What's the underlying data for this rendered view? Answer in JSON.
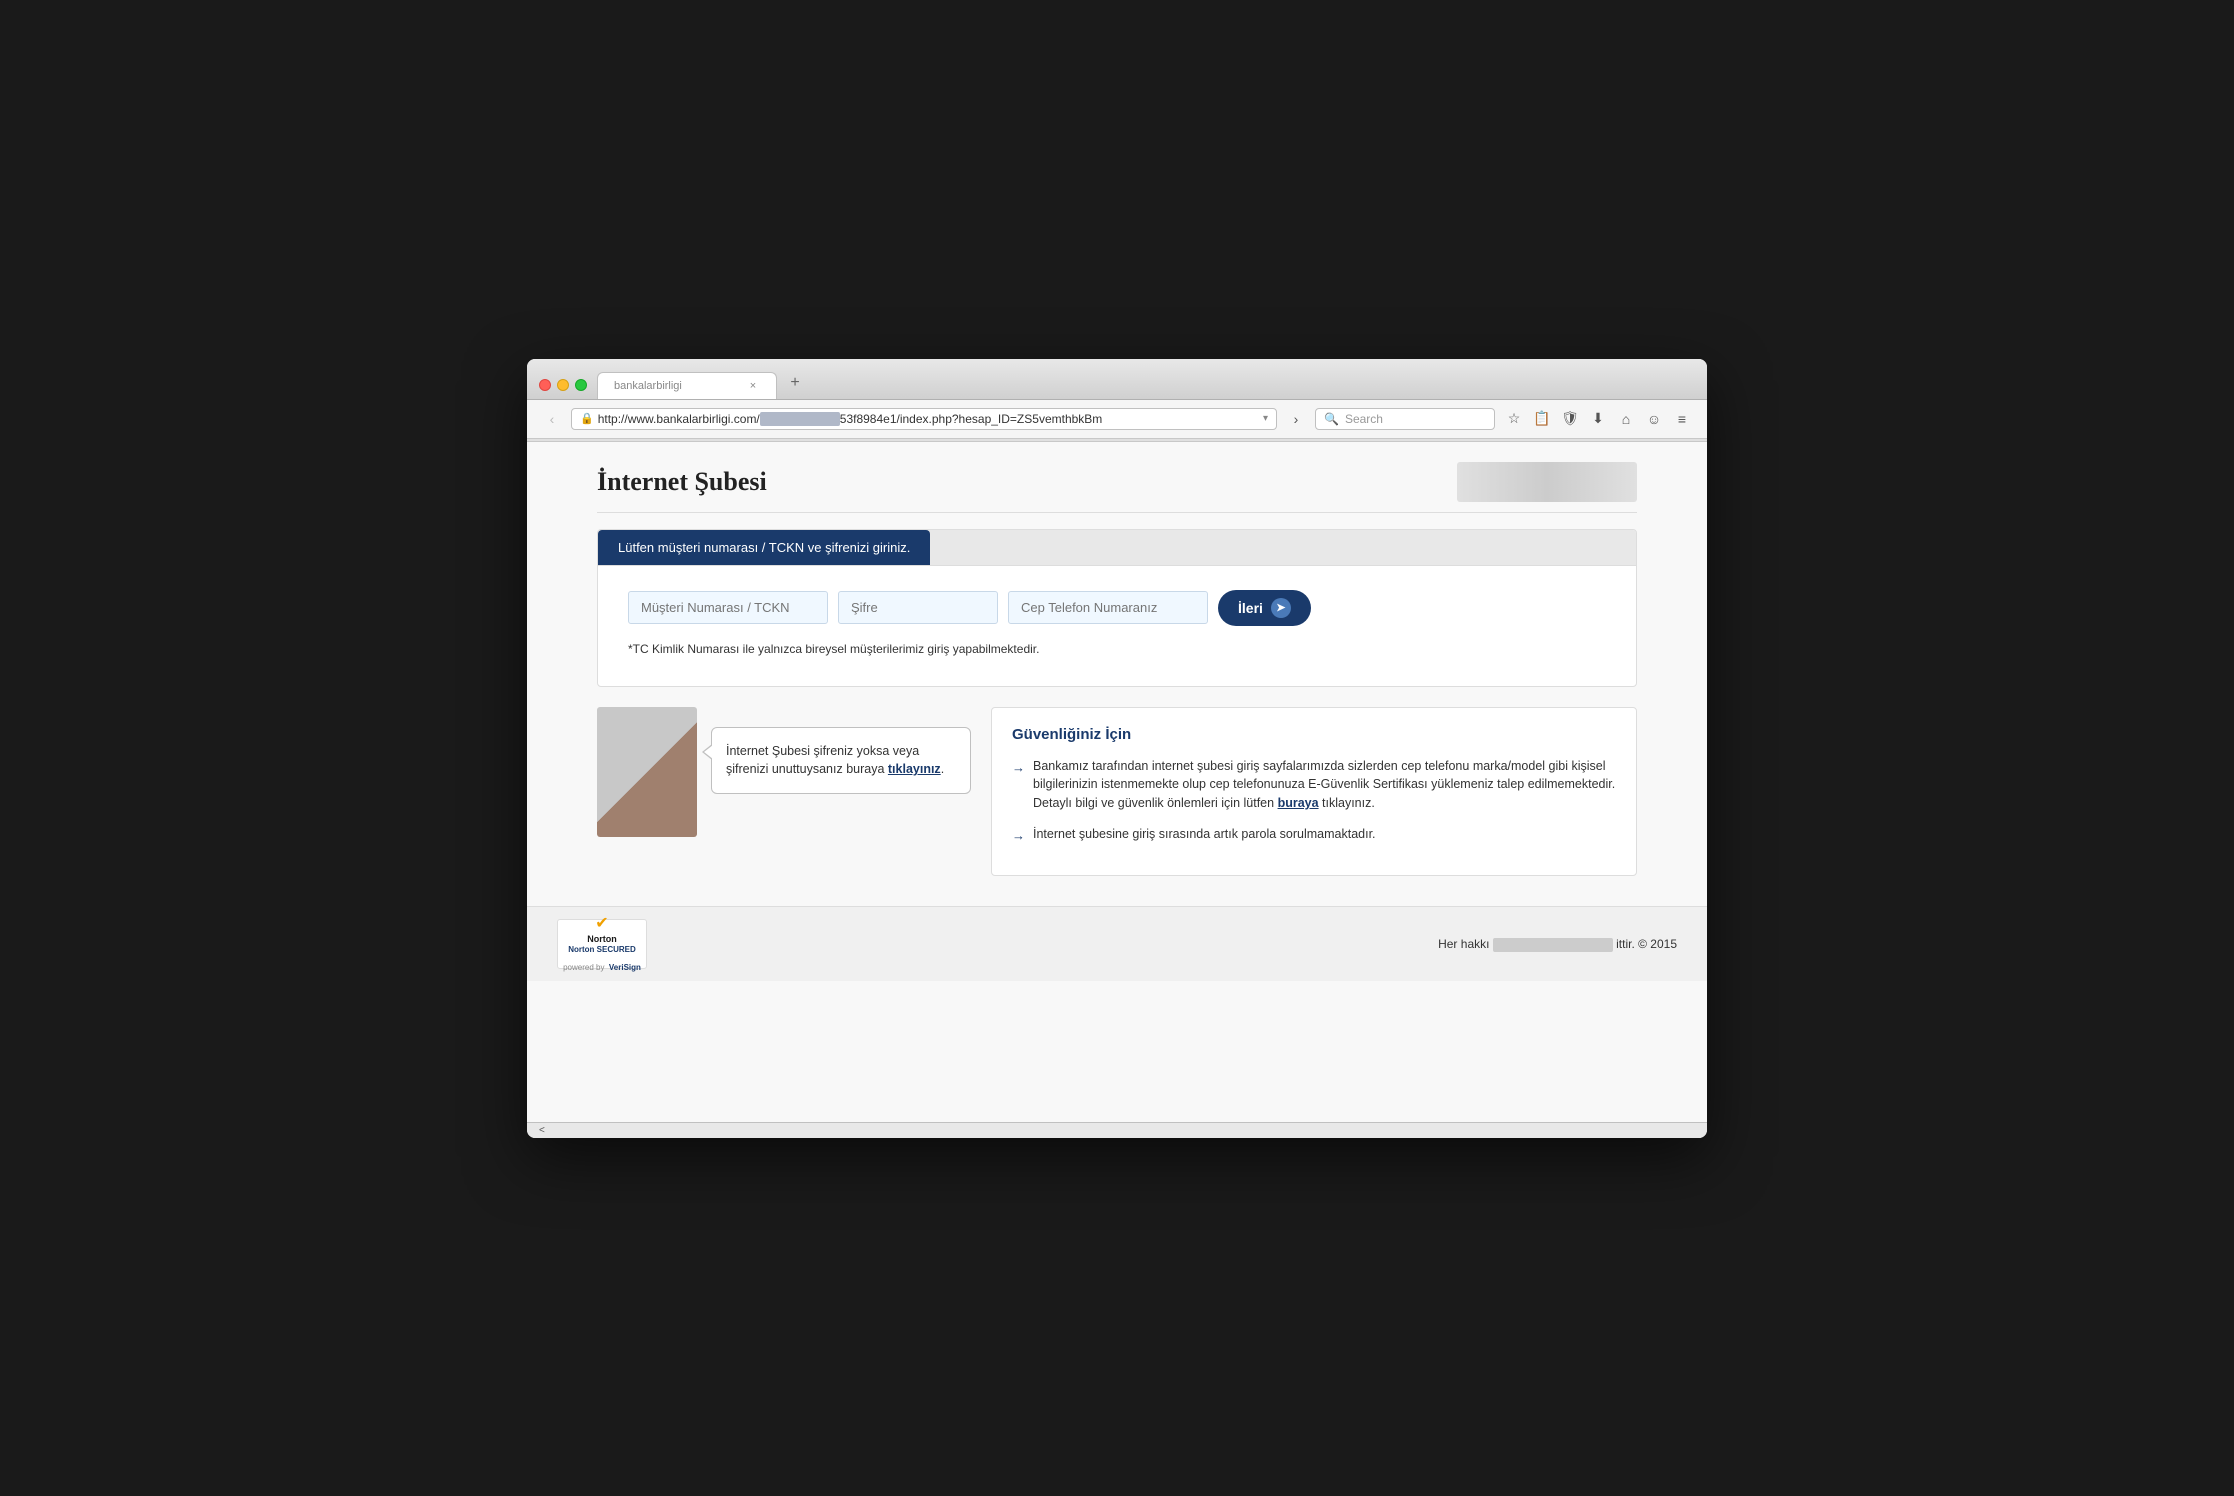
{
  "browser": {
    "tab_title": "bankalarbirligi",
    "tab_close_label": "×",
    "tab_new_label": "+",
    "address_url": "http://www.bankalarbirligi.com/",
    "address_url_rest": "53f8984e1/index.php?hesap_ID=ZS5vemthbkBm",
    "search_placeholder": "Search",
    "nav_back": "‹",
    "nav_forward": "›"
  },
  "page": {
    "title": "İnternet Şubesi",
    "login_tab_label": "Lütfen müşteri numarası / TCKN ve şifrenizi giriniz.",
    "musteri_placeholder": "Müşteri Numarası / TCKN",
    "sifre_placeholder": "Şifre",
    "cep_placeholder": "Cep Telefon Numaranız",
    "ileri_label": "İleri",
    "login_note": "*TC Kimlik Numarası ile yalnızca bireysel müşterilerimiz giriş yapabilmektedir.",
    "speech_text": "İnternet Şubesi şifreniz yoksa veya şifrenizi unuttuysanız buraya ",
    "speech_link_text": "tıklayınız",
    "speech_period": ".",
    "security_title": "Güvenliğiniz İçin",
    "security_item1": "Bankamız tarafından internet şubesi giriş sayfalarımızda sizlerden cep telefonu marka/model gibi kişisel bilgilerinizin istenmemekte olup cep telefonunuza E-Güvenlik Sertifikası yüklemeniz talep edilmemektedir. Detaylı bilgi ve güvenlik önlemleri için lütfen ",
    "security_item1_link": "buraya",
    "security_item1_rest": " tıklayınız.",
    "security_item2": "İnternet şubesine giriş sırasında artık parola sorulmamaktadır.",
    "norton_secured": "Norton SECURED",
    "norton_powered": "powered by",
    "verisign": "VeriSign",
    "footer_copyright": "Her hakkı ",
    "footer_year": "ittir. © 2015",
    "status_bar_text": "<"
  }
}
